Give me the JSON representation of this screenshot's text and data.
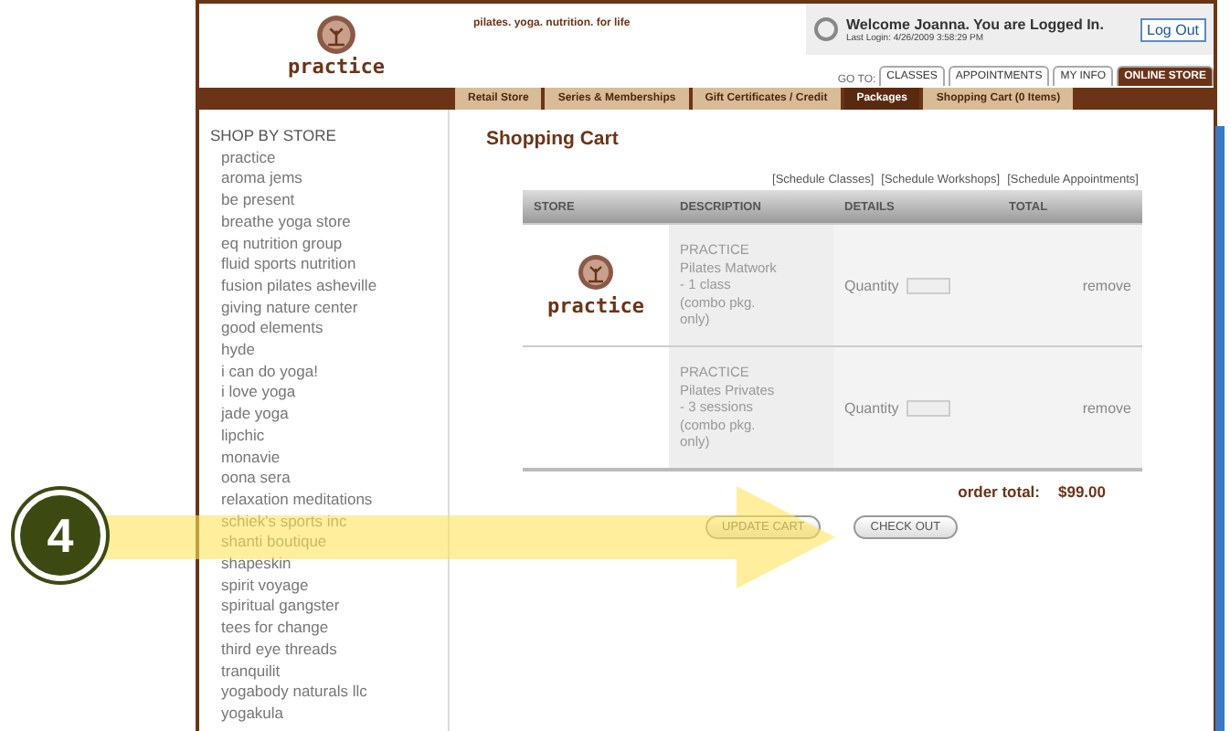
{
  "header": {
    "logo_text": "practice",
    "tagline": "pilates. yoga. nutrition. for life",
    "welcome": "Welcome  Joanna.  You are Logged In.",
    "last_login": "Last Login: 4/26/2009 3:58:29 PM",
    "logout": "Log Out",
    "goto_label": "GO TO:",
    "goto_tabs": [
      {
        "label": "CLASSES",
        "selected": false
      },
      {
        "label": "APPOINTMENTS",
        "selected": false
      },
      {
        "label": "MY INFO",
        "selected": false
      },
      {
        "label": "ONLINE STORE",
        "selected": true
      }
    ]
  },
  "nav_tabs": [
    {
      "label": "Retail Store",
      "selected": false
    },
    {
      "label": "Series & Memberships",
      "selected": false
    },
    {
      "label": "Gift Certificates / Credit",
      "selected": false
    },
    {
      "label": "Packages",
      "selected": true
    },
    {
      "label": "Shopping Cart (0 Items)",
      "selected": false
    }
  ],
  "sidebar": {
    "heading": "SHOP BY STORE",
    "items": [
      "practice",
      "aroma jems",
      "be present",
      "breathe yoga store",
      "eq nutrition group",
      "fluid sports nutrition",
      "fusion pilates asheville",
      "giving nature center",
      "good elements",
      "hyde",
      "i can do yoga!",
      "i love yoga",
      "jade yoga",
      "lipchic",
      "monavie",
      "oona sera",
      "relaxation meditations",
      "schiek's sports inc",
      "shanti boutique",
      "shapeskin",
      "spirit voyage",
      "spiritual gangster",
      "tees for change",
      "third eye threads",
      "tranquilit",
      "yogabody naturals llc",
      "yogakula"
    ]
  },
  "cart": {
    "title": "Shopping Cart",
    "links": [
      "[Schedule Classes]",
      "[Schedule Workshops]",
      "[Schedule Appointments]"
    ],
    "columns": [
      "STORE",
      "DESCRIPTION",
      "DETAILS",
      "TOTAL"
    ],
    "rows": [
      {
        "store_logo_text": "practice",
        "description": [
          "PRACTICE",
          "Pilates Matwork",
          "- 1 class",
          "(combo pkg.",
          "only)"
        ],
        "quantity_label": "Quantity",
        "remove": "remove"
      },
      {
        "description": [
          "PRACTICE",
          "Pilates Privates",
          "- 3 sessions",
          "(combo pkg.",
          "only)"
        ],
        "quantity_label": "Quantity",
        "remove": "remove"
      }
    ],
    "total_label": "order total:",
    "total_value": "$99.00",
    "buttons": [
      "UPDATE CART",
      "CHECK OUT"
    ]
  },
  "annotation": {
    "step": "4"
  }
}
